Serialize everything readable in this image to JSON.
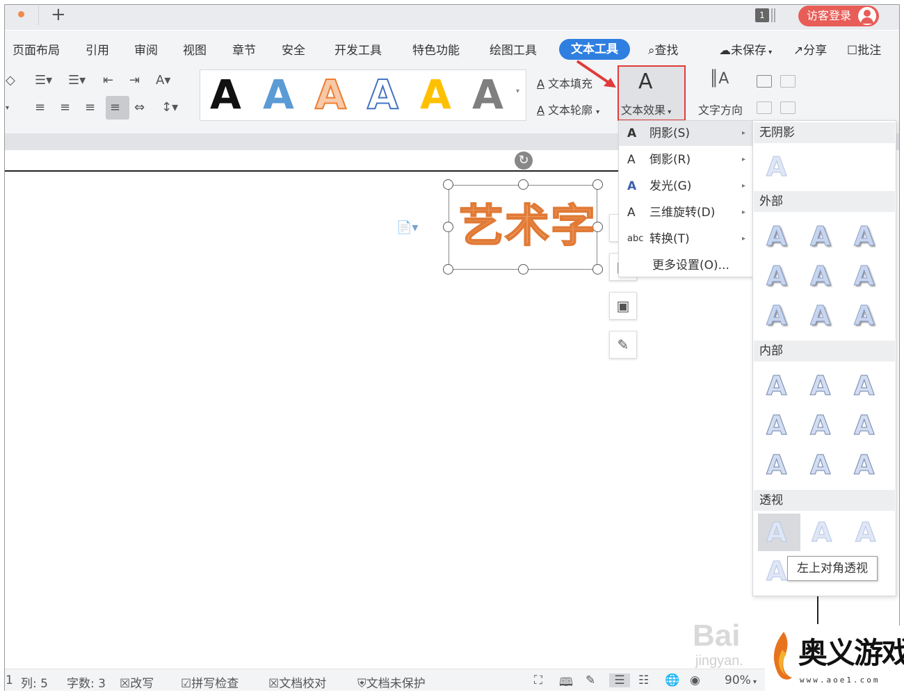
{
  "tabbar": {
    "plus_label": "+",
    "window_count": "1",
    "login_label": "访客登录"
  },
  "menu": {
    "items": [
      "页面布局",
      "引用",
      "审阅",
      "视图",
      "章节",
      "安全",
      "开发工具",
      "特色功能",
      "绘图工具"
    ],
    "active": "文本工具",
    "search": "查找",
    "unsaved": "未保存",
    "share": "分享",
    "comment": "批注"
  },
  "ribbon": {
    "text_fill": "文本填充",
    "text_outline": "文本轮廓",
    "text_effect": "文本效果",
    "text_direction": "文字方向",
    "gallery_letter": "A",
    "gallery_colors": [
      "#111111",
      "#5b9bd5",
      "#ed7d31",
      "#4472c4",
      "#ffc000",
      "#7f7f7f"
    ]
  },
  "document": {
    "art_text": "艺术字"
  },
  "effect_menu": {
    "items": [
      {
        "icon": "A",
        "label": "阴影(S)",
        "has_sub": true
      },
      {
        "icon": "A",
        "label": "倒影(R)",
        "has_sub": true
      },
      {
        "icon": "A",
        "label": "发光(G)",
        "has_sub": true
      },
      {
        "icon": "A",
        "label": "三维旋转(D)",
        "has_sub": true
      },
      {
        "icon": "abc",
        "label": "转换(T)",
        "has_sub": true
      },
      {
        "icon": "",
        "label": "更多设置(O)...",
        "has_sub": false
      }
    ]
  },
  "shadow_sub": {
    "sections": [
      "无阴影",
      "外部",
      "内部",
      "透视"
    ],
    "glyph": "A",
    "tooltip": "左上对角透视"
  },
  "status": {
    "col": "1",
    "line": "列: 5",
    "words": "字数: 3",
    "rewrite": "改写",
    "spell": "拼写检查",
    "proof": "文档校对",
    "protect": "文档未保护",
    "zoom": "90%"
  },
  "watermark": {
    "baidu": "Bai",
    "jingyan": "jingyan.",
    "site_title": "奥义游戏网",
    "site_url": "www.aoe1.com"
  }
}
